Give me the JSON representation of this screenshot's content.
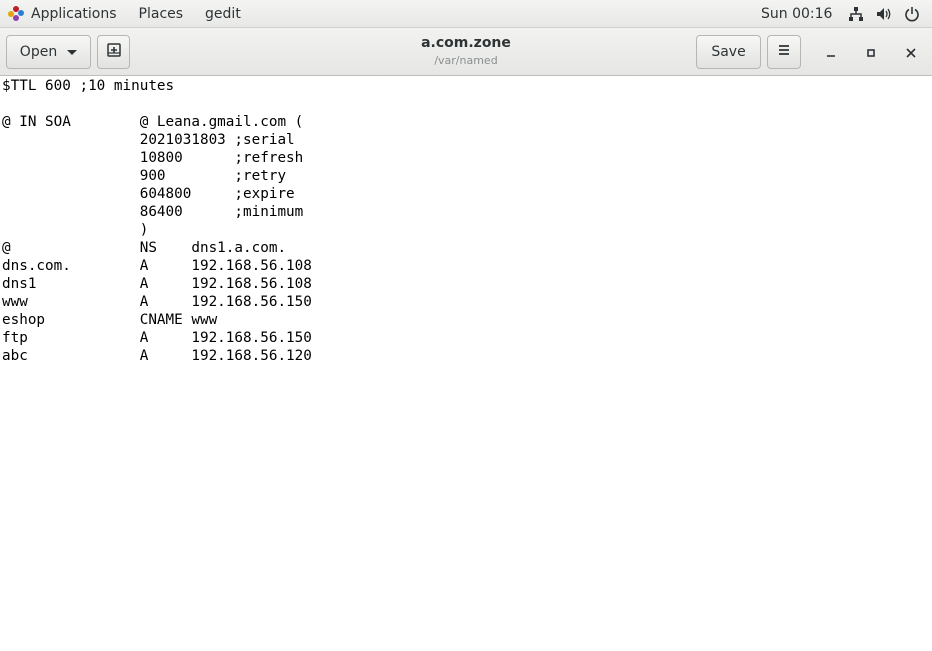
{
  "top_panel": {
    "applications": "Applications",
    "places": "Places",
    "app_name": "gedit",
    "clock": "Sun 00:16"
  },
  "header": {
    "open_label": "Open",
    "title": "a.com.zone",
    "subtitle": "/var/named",
    "save_label": "Save"
  },
  "editor": {
    "lines": [
      "$TTL 600 ;10 minutes",
      "",
      "@ IN SOA        @ Leana.gmail.com (",
      "                2021031803 ;serial",
      "                10800      ;refresh",
      "                900        ;retry",
      "                604800     ;expire",
      "                86400      ;minimum",
      "                )",
      "@               NS    dns1.a.com.",
      "dns.com.        A     192.168.56.108",
      "dns1            A     192.168.56.108",
      "www             A     192.168.56.150",
      "eshop           CNAME www",
      "ftp             A     192.168.56.150",
      "abc             A     192.168.56.120"
    ]
  },
  "colors": {
    "panel_bg": "#ececeb",
    "text": "#2e3436",
    "editor_bg": "#ffffff"
  }
}
